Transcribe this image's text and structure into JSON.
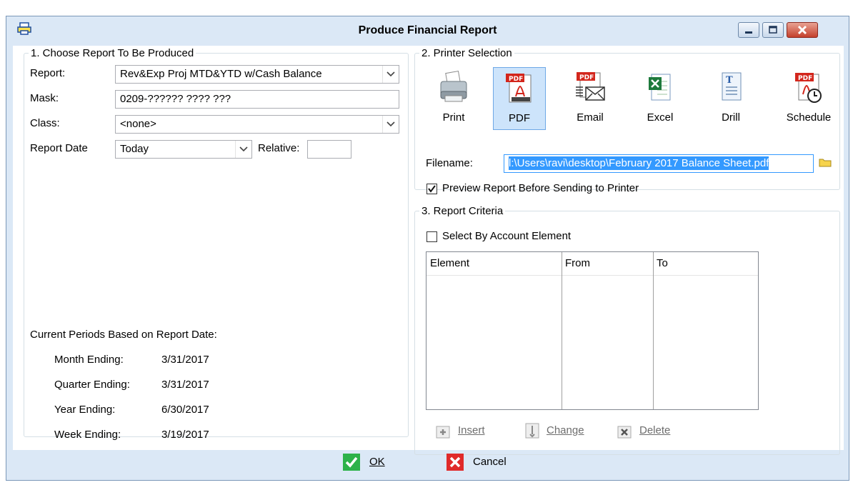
{
  "window": {
    "title": "Produce Financial Report",
    "icon": "printer-icon",
    "controls": [
      "minimize-icon",
      "maximize-icon",
      "close-icon"
    ]
  },
  "choose": {
    "legend": "1. Choose Report To Be Produced",
    "report_label": "Report:",
    "report_value": "Rev&Exp Proj MTD&YTD w/Cash Balance",
    "mask_label": "Mask:",
    "mask_value": "0209-?????? ???? ???",
    "class_label": "Class:",
    "class_value": "<none>",
    "report_date_label": "Report Date",
    "report_date_value": "Today",
    "relative_label": "Relative:",
    "relative_value": "",
    "periods_heading": "Current Periods Based on Report Date:",
    "periods": [
      {
        "label": "Month Ending:",
        "value": "3/31/2017"
      },
      {
        "label": "Quarter Ending:",
        "value": "3/31/2017"
      },
      {
        "label": "Year Ending:",
        "value": "6/30/2017"
      },
      {
        "label": "Week Ending:",
        "value": "3/19/2017"
      }
    ]
  },
  "printer": {
    "legend": "2. Printer Selection",
    "tools": [
      {
        "label": "Print",
        "icon": "printer-icon"
      },
      {
        "label": "PDF",
        "icon": "pdf-icon",
        "selected": true
      },
      {
        "label": "Email",
        "icon": "email-icon"
      },
      {
        "label": "Excel",
        "icon": "excel-icon"
      },
      {
        "label": "Drill",
        "icon": "drill-document-icon"
      },
      {
        "label": "Schedule",
        "icon": "schedule-icon"
      }
    ],
    "filename_label": "Filename:",
    "filename_value": "l:\\Users\\ravi\\desktop\\February 2017 Balance Sheet.pdf",
    "preview_label": "Preview Report Before Sending to Printer",
    "preview_checked": true
  },
  "criteria": {
    "legend": "3. Report Criteria",
    "select_by_label": "Select By Account Element",
    "select_by_checked": false,
    "columns": [
      "Element",
      "From",
      "To"
    ],
    "rows": [],
    "insert_label": "Insert",
    "change_label": "Change",
    "delete_label": "Delete"
  },
  "footer": {
    "ok_label": "OK",
    "cancel_label": "Cancel"
  },
  "colors": {
    "frame": "#dbe8f6",
    "selection": "#3399ff",
    "ok_green": "#2db24a",
    "cancel_red": "#e02a2a"
  }
}
